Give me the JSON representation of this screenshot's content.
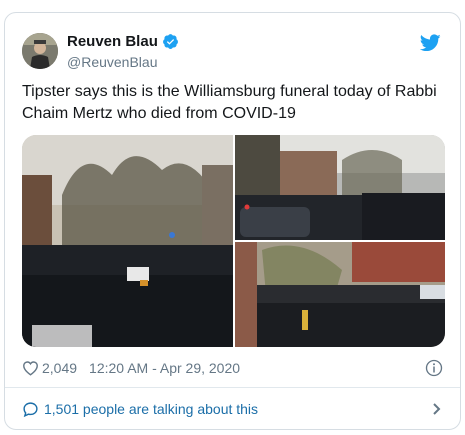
{
  "author": {
    "display_name": "Reuven Blau",
    "handle": "@ReuvenBlau",
    "verified": true
  },
  "tweet": {
    "text": "Tipster says this is the Williamsburg funeral today of Rabbi Chaim Mertz who died from COVID-19"
  },
  "media": {
    "photo_count": 3
  },
  "stats": {
    "likes": "2,049",
    "timestamp": "12:20 AM - Apr 29, 2020"
  },
  "footer": {
    "conversation_label": "1,501 people are talking about this"
  },
  "icons": {
    "logo": "twitter-bird-icon",
    "verified": "verified-badge-icon",
    "like": "heart-icon",
    "info": "info-icon",
    "reply": "speech-bubble-icon",
    "chevron": "chevron-right-icon"
  },
  "colors": {
    "brand": "#1da1f2",
    "link": "#1b6ea8",
    "muted": "#657786",
    "text": "#14171a",
    "border": "#d6dde3"
  }
}
